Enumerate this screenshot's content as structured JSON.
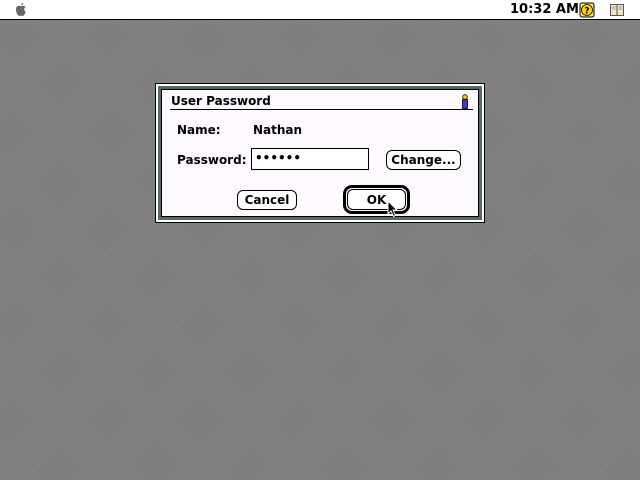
{
  "menubar": {
    "apple_icon": "apple-icon",
    "clock": "10:32 AM",
    "help_icon": "help-icon",
    "app_icon": "application-menu-icon"
  },
  "dialog": {
    "title": "User Password",
    "title_icon": "key-icon",
    "name_label": "Name:",
    "name_value": "Nathan",
    "password_label": "Password:",
    "password_value": "••••••",
    "change_button": "Change...",
    "cancel_button": "Cancel",
    "ok_button": "OK",
    "frame_color": "#556b5e"
  }
}
